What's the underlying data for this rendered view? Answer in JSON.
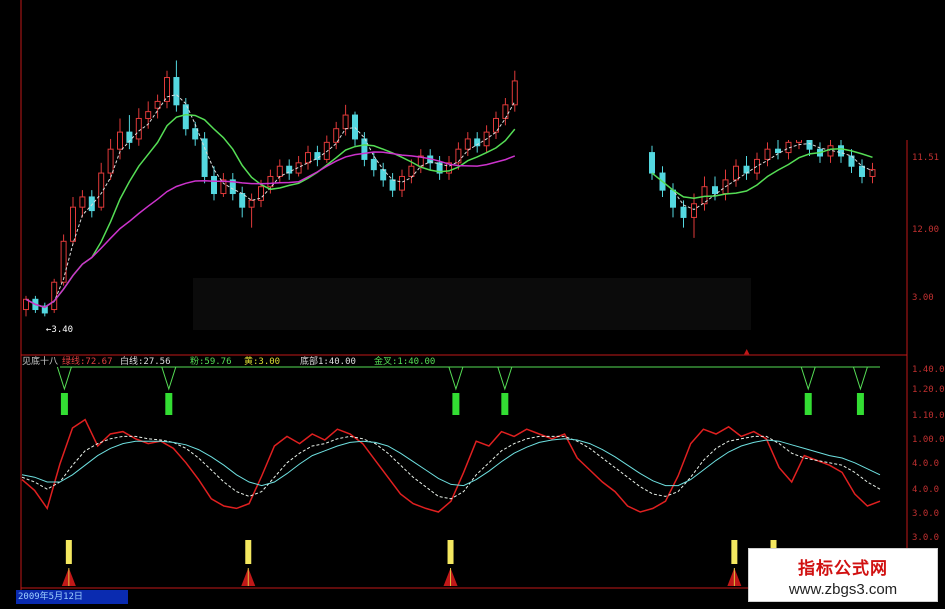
{
  "chart_data": [
    {
      "panel": "price",
      "type": "candlestick",
      "annotation": "←3.40",
      "axis_labels": [
        "11.51",
        "12.00",
        "3.00"
      ],
      "candles": [
        {
          "o": 3.6,
          "c": 3.9,
          "h": 4.0,
          "l": 3.4
        },
        {
          "o": 3.9,
          "c": 3.6,
          "h": 4.0,
          "l": 3.5
        },
        {
          "o": 3.7,
          "c": 3.5,
          "h": 3.8,
          "l": 3.4
        },
        {
          "o": 3.6,
          "c": 4.4,
          "h": 4.5,
          "l": 3.5
        },
        {
          "o": 4.4,
          "c": 5.6,
          "h": 5.8,
          "l": 4.3
        },
        {
          "o": 5.6,
          "c": 6.6,
          "h": 6.9,
          "l": 5.5
        },
        {
          "o": 6.6,
          "c": 6.9,
          "h": 7.1,
          "l": 6.3
        },
        {
          "o": 6.9,
          "c": 6.5,
          "h": 7.1,
          "l": 6.3
        },
        {
          "o": 6.6,
          "c": 7.6,
          "h": 7.9,
          "l": 6.5
        },
        {
          "o": 7.6,
          "c": 8.3,
          "h": 8.6,
          "l": 7.4
        },
        {
          "o": 8.3,
          "c": 8.8,
          "h": 9.2,
          "l": 8.0
        },
        {
          "o": 8.8,
          "c": 8.5,
          "h": 9.3,
          "l": 8.3
        },
        {
          "o": 8.6,
          "c": 9.2,
          "h": 9.5,
          "l": 8.4
        },
        {
          "o": 9.2,
          "c": 9.4,
          "h": 9.7,
          "l": 8.9
        },
        {
          "o": 9.5,
          "c": 9.7,
          "h": 9.9,
          "l": 9.2
        },
        {
          "o": 9.7,
          "c": 10.4,
          "h": 10.6,
          "l": 9.5
        },
        {
          "o": 10.4,
          "c": 9.6,
          "h": 10.9,
          "l": 9.4
        },
        {
          "o": 9.6,
          "c": 8.9,
          "h": 9.8,
          "l": 8.7
        },
        {
          "o": 8.9,
          "c": 8.6,
          "h": 9.1,
          "l": 8.4
        },
        {
          "o": 8.6,
          "c": 7.5,
          "h": 8.8,
          "l": 7.3
        },
        {
          "o": 7.5,
          "c": 7.0,
          "h": 7.8,
          "l": 6.8
        },
        {
          "o": 7.0,
          "c": 7.4,
          "h": 7.6,
          "l": 6.9
        },
        {
          "o": 7.4,
          "c": 7.0,
          "h": 7.6,
          "l": 6.8
        },
        {
          "o": 7.0,
          "c": 6.6,
          "h": 7.2,
          "l": 6.3
        },
        {
          "o": 6.6,
          "c": 6.8,
          "h": 7.0,
          "l": 6.0
        },
        {
          "o": 6.8,
          "c": 7.2,
          "h": 7.4,
          "l": 6.6
        },
        {
          "o": 7.2,
          "c": 7.5,
          "h": 7.7,
          "l": 7.0
        },
        {
          "o": 7.5,
          "c": 7.8,
          "h": 8.0,
          "l": 7.3
        },
        {
          "o": 7.8,
          "c": 7.6,
          "h": 8.0,
          "l": 7.4
        },
        {
          "o": 7.6,
          "c": 7.9,
          "h": 8.1,
          "l": 7.5
        },
        {
          "o": 7.9,
          "c": 8.2,
          "h": 8.4,
          "l": 7.7
        },
        {
          "o": 8.2,
          "c": 8.0,
          "h": 8.4,
          "l": 7.8
        },
        {
          "o": 8.0,
          "c": 8.5,
          "h": 8.7,
          "l": 7.9
        },
        {
          "o": 8.5,
          "c": 8.9,
          "h": 9.1,
          "l": 8.3
        },
        {
          "o": 8.9,
          "c": 9.3,
          "h": 9.6,
          "l": 8.7
        },
        {
          "o": 9.3,
          "c": 8.6,
          "h": 9.4,
          "l": 8.4
        },
        {
          "o": 8.6,
          "c": 8.0,
          "h": 8.8,
          "l": 7.8
        },
        {
          "o": 8.0,
          "c": 7.7,
          "h": 8.2,
          "l": 7.5
        },
        {
          "o": 7.7,
          "c": 7.4,
          "h": 7.9,
          "l": 7.2
        },
        {
          "o": 7.4,
          "c": 7.1,
          "h": 7.6,
          "l": 6.9
        },
        {
          "o": 7.1,
          "c": 7.5,
          "h": 7.7,
          "l": 6.9
        },
        {
          "o": 7.5,
          "c": 7.8,
          "h": 8.0,
          "l": 7.3
        },
        {
          "o": 7.8,
          "c": 8.1,
          "h": 8.3,
          "l": 7.6
        },
        {
          "o": 8.1,
          "c": 7.9,
          "h": 8.3,
          "l": 7.7
        },
        {
          "o": 7.9,
          "c": 7.6,
          "h": 8.1,
          "l": 7.4
        },
        {
          "o": 7.6,
          "c": 7.9,
          "h": 8.1,
          "l": 7.4
        },
        {
          "o": 7.9,
          "c": 8.3,
          "h": 8.5,
          "l": 7.7
        },
        {
          "o": 8.3,
          "c": 8.6,
          "h": 8.8,
          "l": 8.1
        },
        {
          "o": 8.6,
          "c": 8.4,
          "h": 8.8,
          "l": 8.2
        },
        {
          "o": 8.4,
          "c": 8.8,
          "h": 9.0,
          "l": 8.2
        },
        {
          "o": 8.8,
          "c": 9.2,
          "h": 9.4,
          "l": 8.6
        },
        {
          "o": 9.2,
          "c": 9.6,
          "h": 9.8,
          "l": 9.0
        },
        {
          "o": 9.6,
          "c": 10.3,
          "h": 10.6,
          "l": 9.4
        }
      ],
      "candles_right": [
        {
          "o": 8.2,
          "c": 7.6,
          "h": 8.4,
          "l": 7.4
        },
        {
          "o": 7.6,
          "c": 7.1,
          "h": 7.8,
          "l": 6.9
        },
        {
          "o": 7.1,
          "c": 6.6,
          "h": 7.3,
          "l": 6.3
        },
        {
          "o": 6.6,
          "c": 6.3,
          "h": 6.8,
          "l": 6.0
        },
        {
          "o": 6.3,
          "c": 6.7,
          "h": 7.0,
          "l": 5.7
        },
        {
          "o": 6.7,
          "c": 7.2,
          "h": 7.5,
          "l": 6.5
        },
        {
          "o": 7.2,
          "c": 7.0,
          "h": 7.5,
          "l": 6.8
        },
        {
          "o": 7.0,
          "c": 7.4,
          "h": 7.7,
          "l": 6.8
        },
        {
          "o": 7.4,
          "c": 7.8,
          "h": 8.0,
          "l": 7.2
        },
        {
          "o": 7.8,
          "c": 7.6,
          "h": 8.1,
          "l": 7.4
        },
        {
          "o": 7.6,
          "c": 8.0,
          "h": 8.2,
          "l": 7.4
        },
        {
          "o": 8.0,
          "c": 8.3,
          "h": 8.5,
          "l": 7.8
        },
        {
          "o": 8.3,
          "c": 8.2,
          "h": 8.6,
          "l": 8.0
        },
        {
          "o": 8.2,
          "c": 8.5,
          "h": 8.7,
          "l": 8.0
        },
        {
          "o": 8.5,
          "c": 8.6,
          "h": 8.9,
          "l": 8.3
        },
        {
          "o": 8.6,
          "c": 8.3,
          "h": 8.9,
          "l": 8.1
        },
        {
          "o": 8.3,
          "c": 8.1,
          "h": 8.5,
          "l": 7.9
        },
        {
          "o": 8.1,
          "c": 8.4,
          "h": 8.6,
          "l": 7.9
        },
        {
          "o": 8.4,
          "c": 8.1,
          "h": 8.6,
          "l": 7.9
        },
        {
          "o": 8.1,
          "c": 7.8,
          "h": 8.3,
          "l": 7.6
        },
        {
          "o": 7.8,
          "c": 7.5,
          "h": 8.0,
          "l": 7.3
        },
        {
          "o": 7.5,
          "c": 7.7,
          "h": 7.9,
          "l": 7.3
        }
      ]
    },
    {
      "panel": "indicator",
      "type": "line",
      "axis_labels": [
        "1.40.0",
        "1.20.0",
        "1.10.0",
        "1.00.0",
        "4.0.0",
        "4.0.0",
        "3.0.0",
        "3.0.0"
      ],
      "series": [
        {
          "name": "",
          "color": "#e02020",
          "values": [
            42,
            33,
            18,
            55,
            85,
            92,
            70,
            80,
            82,
            76,
            72,
            74,
            68,
            56,
            42,
            26,
            20,
            18,
            22,
            45,
            70,
            78,
            72,
            80,
            75,
            84,
            80,
            72,
            58,
            44,
            30,
            22,
            18,
            15,
            24,
            48,
            74,
            70,
            82,
            78,
            84,
            80,
            76,
            80,
            60,
            50,
            40,
            32,
            20,
            15,
            18,
            24,
            45,
            72,
            84,
            80,
            86,
            78,
            82,
            76,
            52,
            40,
            62,
            58,
            54,
            48,
            30,
            20,
            24
          ]
        },
        {
          "name": "",
          "color": "#e8f0e8",
          "values": [
            44,
            40,
            34,
            40,
            54,
            66,
            72,
            76,
            78,
            78,
            76,
            75,
            73,
            68,
            60,
            50,
            40,
            32,
            28,
            32,
            44,
            56,
            64,
            70,
            72,
            76,
            78,
            76,
            72,
            64,
            54,
            44,
            36,
            28,
            26,
            32,
            46,
            56,
            66,
            72,
            76,
            78,
            78,
            78,
            74,
            68,
            60,
            52,
            44,
            36,
            30,
            28,
            32,
            44,
            58,
            68,
            74,
            76,
            78,
            78,
            72,
            64,
            60,
            58,
            56,
            54,
            48,
            40,
            34
          ]
        },
        {
          "name": "",
          "color": "#6ee0e0",
          "values": [
            46,
            44,
            40,
            40,
            46,
            54,
            62,
            68,
            72,
            74,
            74,
            74,
            73,
            71,
            67,
            61,
            54,
            46,
            40,
            37,
            40,
            47,
            55,
            62,
            66,
            70,
            73,
            74,
            73,
            70,
            64,
            57,
            50,
            43,
            38,
            37,
            42,
            49,
            57,
            64,
            69,
            73,
            75,
            76,
            75,
            72,
            67,
            61,
            54,
            47,
            41,
            37,
            37,
            42,
            50,
            58,
            65,
            70,
            73,
            75,
            74,
            71,
            68,
            65,
            62,
            60,
            56,
            51,
            46
          ]
        }
      ],
      "signals_green": [
        13,
        45,
        133,
        148,
        241,
        257
      ],
      "signals_yellow": [
        7,
        62,
        124,
        211,
        223
      ]
    }
  ],
  "watermark": {
    "title": "指标公式网",
    "url": "www.zbgs3.com"
  },
  "bottom_label": "2009年5月12日",
  "indicator_header": [
    "见底十八",
    "绿线:72.67",
    "白线:27.56",
    "粉:59.76",
    "黄:3.00",
    "底部1:40.00",
    "金叉:1:40.00"
  ]
}
